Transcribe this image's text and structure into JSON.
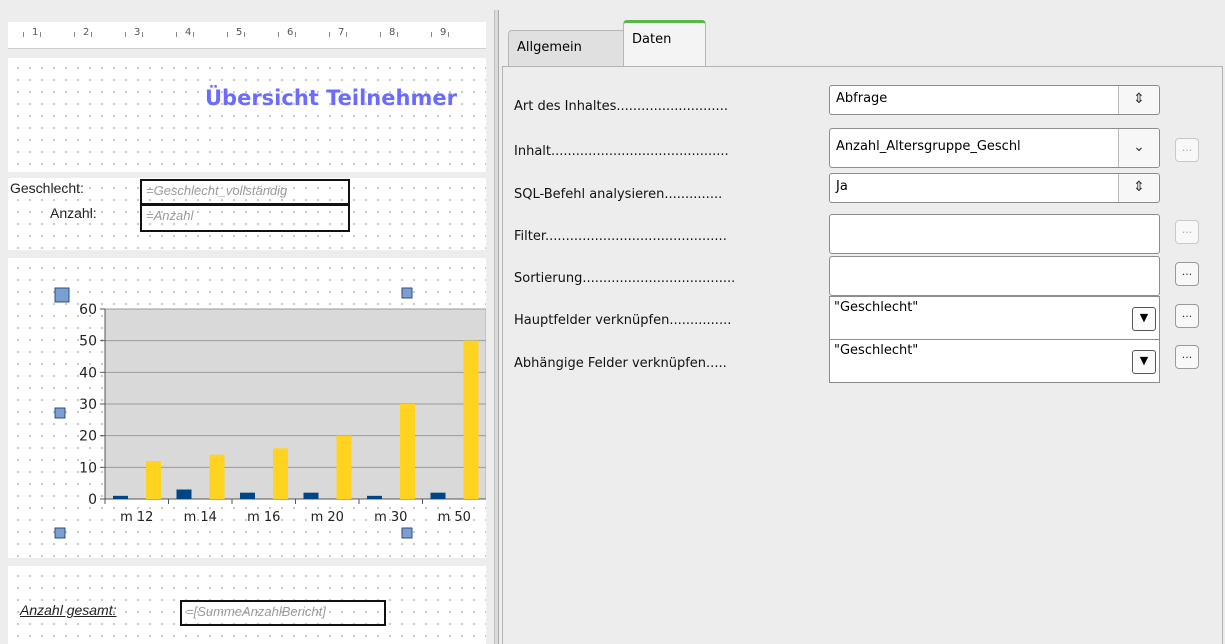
{
  "ruler": {
    "ticks": [
      "1",
      "2",
      "3",
      "4",
      "5",
      "6",
      "7",
      "8",
      "9"
    ]
  },
  "report": {
    "title": "Übersicht Teilnehmer",
    "detail": {
      "label_gender": "Geschlecht:",
      "field_gender": "=Geschlecht_vollständig",
      "label_count": "Anzahl:",
      "field_count": "=Anzahl"
    },
    "footer": {
      "label_total": "Anzahl gesamt:",
      "field_total": "=[SummeAnzahlBericht]"
    }
  },
  "chart_data": {
    "type": "bar",
    "categories": [
      "m 12",
      "m 14",
      "m 16",
      "m 20",
      "m 30",
      "m 50"
    ],
    "series": [
      {
        "values": [
          1,
          3,
          2,
          2,
          1,
          2
        ],
        "color": "#004586"
      },
      {
        "values": [
          12,
          14,
          16,
          20,
          30,
          50
        ],
        "color": "#ffd320"
      }
    ],
    "yticks": [
      "0",
      "10",
      "20",
      "30",
      "40",
      "50",
      "60"
    ],
    "ylim": [
      0,
      60
    ],
    "grid": true,
    "plot_bg": "#d9d9d9"
  },
  "panel": {
    "tabs": [
      {
        "label": "Allgemein",
        "active": false
      },
      {
        "label": "Daten",
        "active": true
      }
    ],
    "rows": {
      "content_type": {
        "label": "Art des Inhaltes...........................",
        "value": "Abfrage",
        "spin": "⇕"
      },
      "content": {
        "label": "Inhalt...........................................",
        "value": "Anzahl_Altersgruppe_Geschl",
        "chevron": "⌄",
        "button": "..."
      },
      "analyze_sql": {
        "label": "SQL-Befehl analysieren..............",
        "value": "Ja",
        "spin": "⇕"
      },
      "filter": {
        "label": "Filter............................................",
        "value": "",
        "button": "..."
      },
      "sort": {
        "label": "Sortierung.....................................",
        "value": "",
        "button": "..."
      },
      "master_fields": {
        "label": "Hauptfelder verknüpfen...............",
        "value": "\"Geschlecht\"",
        "arrow": "▼",
        "button": "..."
      },
      "slave_fields": {
        "label": "Abhängige Felder verknüpfen.....",
        "value": "\"Geschlecht\"",
        "arrow": "▼",
        "button": "..."
      }
    }
  }
}
